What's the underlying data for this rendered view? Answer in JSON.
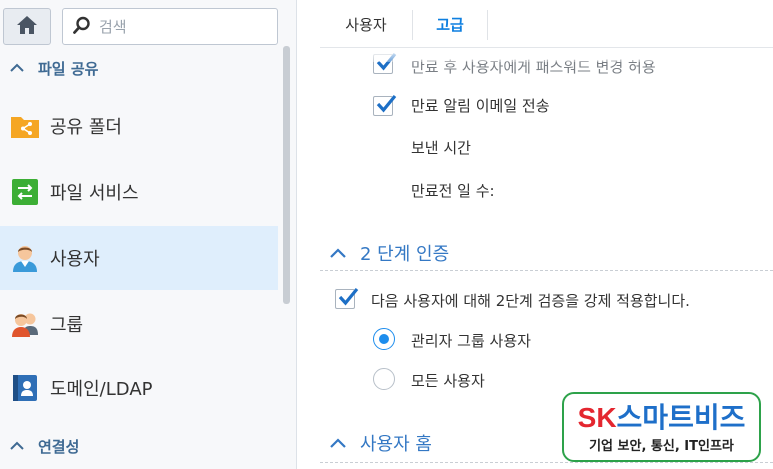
{
  "sidebar": {
    "search": {
      "placeholder": "검색",
      "value": ""
    },
    "sections": [
      {
        "label": "파일 공유"
      },
      {
        "label": "연결성"
      }
    ],
    "items": [
      {
        "label": "공유 폴더",
        "icon": "shared-folder-icon",
        "color": "#f5a623"
      },
      {
        "label": "파일 서비스",
        "icon": "file-services-icon",
        "color": "#3cae35"
      },
      {
        "label": "사용자",
        "icon": "user-icon",
        "selected": true
      },
      {
        "label": "그룹",
        "icon": "group-icon"
      },
      {
        "label": "도메인/LDAP",
        "icon": "domain-ldap-icon",
        "color": "#2f6fb6"
      }
    ]
  },
  "main": {
    "tabs": [
      {
        "label": "사용자",
        "active": false
      },
      {
        "label": "고급",
        "active": true
      }
    ],
    "expiry": {
      "allow_change_label": "만료 후 사용자에게 패스워드 변경 허용",
      "allow_change_checked": true,
      "notify_email_label": "만료 알림 이메일 전송",
      "notify_email_checked": true,
      "send_time_label": "보낸 시간",
      "days_before_label": "만료전 일 수:"
    },
    "two_factor": {
      "title": "2 단계 인증",
      "enforce_label": "다음 사용자에 대해 2단계 검증을 강제 적용합니다.",
      "enforce_checked": true,
      "options": [
        {
          "label": "관리자 그룹 사용자",
          "selected": true
        },
        {
          "label": "모든 사용자",
          "selected": false
        }
      ]
    },
    "user_home": {
      "title": "사용자 홈"
    }
  },
  "watermark": {
    "brand_sk": "SK",
    "brand_rest": "스마트비즈",
    "tagline": "기업 보안, 통신, IT인프라"
  },
  "colors": {
    "accent": "#0e7fe0",
    "section_title": "#3478c4",
    "selected_row": "#dfeefc"
  }
}
